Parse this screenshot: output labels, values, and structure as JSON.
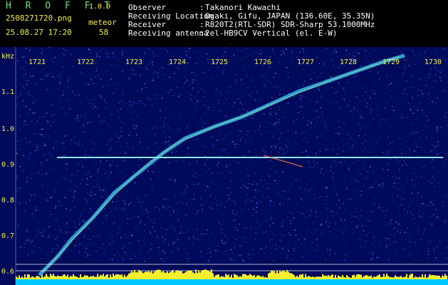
{
  "app": {
    "name": "H R O F F T",
    "version": "1.0.0",
    "filename": "2508271720.png",
    "datetime": "25.08.27 17:20",
    "counter_label": "meteor",
    "counter_value": "58"
  },
  "info": [
    {
      "key": "Observer",
      "sep": ":",
      "value": "Takanori Kawachi"
    },
    {
      "key": "Receiving Location",
      "sep": ":",
      "value": "Ogaki, Gifu, JAPAN (136.60E, 35.35N)"
    },
    {
      "key": "Receiver",
      "sep": ":",
      "value": "R820T2(RTL-SDR) SDR-Sharp 53.1000MHz"
    },
    {
      "key": "Receiving antenna",
      "sep": ":",
      "value": "2el-HB9CV Vertical (el. E-W)"
    }
  ],
  "plot": {
    "unit": "kHz",
    "time_ticks": [
      "1721",
      "1722",
      "1723",
      "1724",
      "1725",
      "1726",
      "1727",
      "1728",
      "1729",
      "1730"
    ],
    "freq_ticks": [
      "1.1",
      "1.0",
      "0.9",
      "0.8",
      "0.7",
      "0.6"
    ],
    "colors": {
      "background": "#000a5a",
      "trace": "#3ad6ff",
      "carrier": "#8fe3ff",
      "tick": "#f5f04a",
      "baseline": "#f7ef2c"
    }
  }
}
